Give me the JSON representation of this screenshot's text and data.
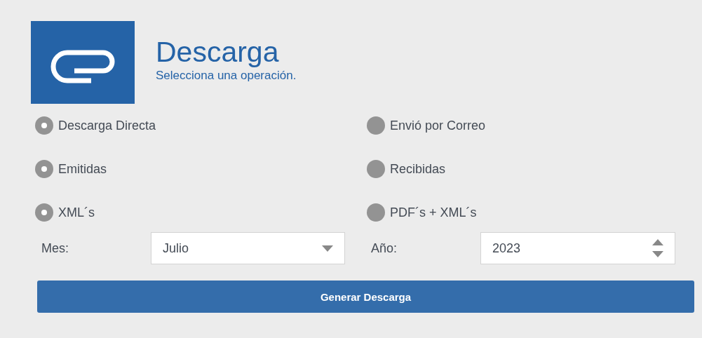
{
  "header": {
    "title": "Descarga",
    "subtitle": "Selecciona una operación."
  },
  "option_groups": [
    {
      "options": [
        {
          "label": "Descarga Directa",
          "selected": true
        },
        {
          "label": "Envió por Correo",
          "selected": false
        }
      ]
    },
    {
      "options": [
        {
          "label": "Emitidas",
          "selected": true
        },
        {
          "label": "Recibidas",
          "selected": false
        }
      ]
    },
    {
      "options": [
        {
          "label": "XML´s",
          "selected": true
        },
        {
          "label": "PDF´s + XML´s",
          "selected": false
        }
      ]
    }
  ],
  "month": {
    "label": "Mes:",
    "value": "Julio"
  },
  "year": {
    "label": "Año:",
    "value": "2023"
  },
  "submit_button": "Generar Descarga"
}
